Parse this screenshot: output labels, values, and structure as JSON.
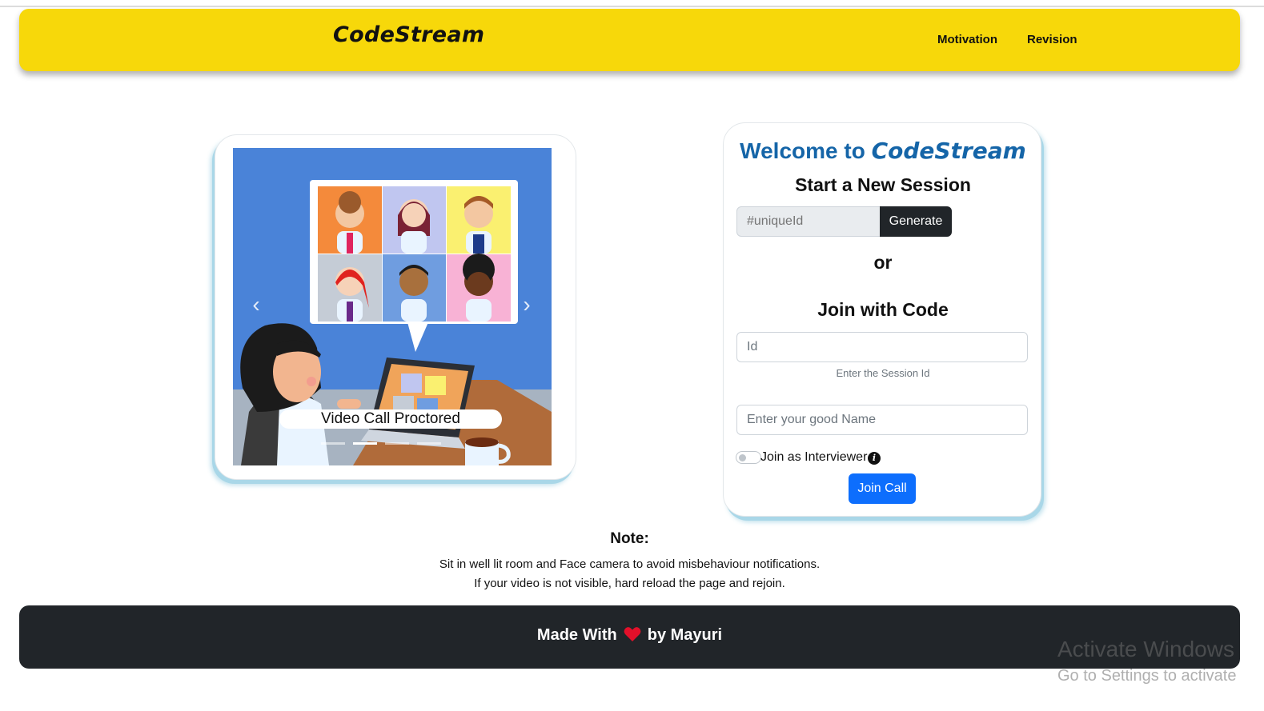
{
  "navbar": {
    "brand": "CodeStream",
    "links": [
      "Motivation",
      "Revision"
    ],
    "color": "#f7d80a"
  },
  "carousel": {
    "caption": "Video Call Proctored",
    "prev_label": "‹",
    "next_label": "›",
    "slide_count": 3,
    "active_slide": 1
  },
  "join_card": {
    "welcome_prefix": "Welcome to ",
    "welcome_brand": "CodeStream",
    "new_session_title": "Start a New Session",
    "unique_placeholder": "#uniqueId",
    "generate_label": "Generate",
    "or_label": "or",
    "join_title": "Join with Code",
    "id_placeholder": "Id",
    "id_help": "Enter the Session Id",
    "name_placeholder": "Enter your good Name",
    "interviewer_label": "Join as Interviewer",
    "info_glyph": "i",
    "join_label": "Join Call",
    "accent": "#1565a8",
    "primary": "#0d6efd"
  },
  "note": {
    "title": "Note:",
    "lines": [
      "Sit in well lit room and Face camera to avoid misbehaviour notifications.",
      "If your video is not visible, hard reload the page and rejoin."
    ]
  },
  "footer": {
    "prefix": "Made With",
    "suffix": "by Mayuri",
    "heart_icon": "heart-icon"
  },
  "watermark": {
    "line1": "Activate Windows",
    "line2": "Go to Settings to activate"
  }
}
